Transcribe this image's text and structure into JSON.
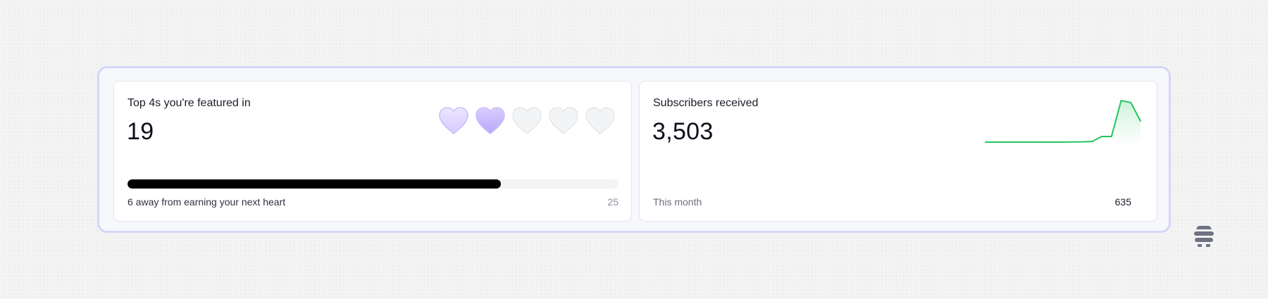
{
  "cards": {
    "top4s": {
      "title": "Top 4s you're featured in",
      "value": "19",
      "hearts": {
        "total": 5,
        "earned": 2
      },
      "progress": {
        "current": 19,
        "goal": 25,
        "fraction": 0.76
      },
      "footer_text": "6 away from earning your next heart",
      "goal_label": "25"
    },
    "subscribers": {
      "title": "Subscribers received",
      "value": "3,503",
      "footer_label": "This month",
      "footer_value": "635"
    }
  },
  "chart_data": {
    "type": "line",
    "title": "",
    "series": [
      {
        "values": [
          0,
          0,
          0,
          0,
          0,
          0,
          0,
          0,
          0,
          0.3,
          0.4,
          1.0,
          8.5,
          8.5,
          63,
          60,
          32
        ]
      }
    ],
    "color": "#22c55e",
    "ylim": [
      0,
      63
    ]
  },
  "colors": {
    "frame_border": "#d5d6f7",
    "heart_earned": "#c4b5fd",
    "heart_empty": "#e5e7eb",
    "progress_fill": "#000000",
    "sparkline": "#22c55e"
  },
  "brand": {
    "icon": "beehiiv-logo-icon"
  }
}
